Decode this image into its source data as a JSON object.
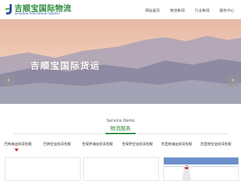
{
  "header": {
    "logo_cn": "吉顺宝国际物流",
    "logo_en": "Jishunbao International Logistics",
    "nav": [
      "网站首页",
      "物流新闻",
      "行业新闻",
      "服务中心"
    ]
  },
  "banner": {
    "headline": "吉顺宝国际货运",
    "prev_arrow": "‹",
    "next_arrow": "›"
  },
  "services": {
    "title_en": "Service items",
    "title_cn": "物流服务",
    "tabs": [
      "巴西海运双清包税",
      "巴西空运双清包税",
      "圣保罗海运双清包税",
      "圣保罗空运双清包税",
      "苏里南海运双清包税",
      "苏里南空运双清包税"
    ],
    "active_tab_index": 0
  },
  "colors": {
    "brand_green": "#2e8b3a",
    "brand_blue": "#1d4f9c",
    "active_caret": "#d62020"
  }
}
